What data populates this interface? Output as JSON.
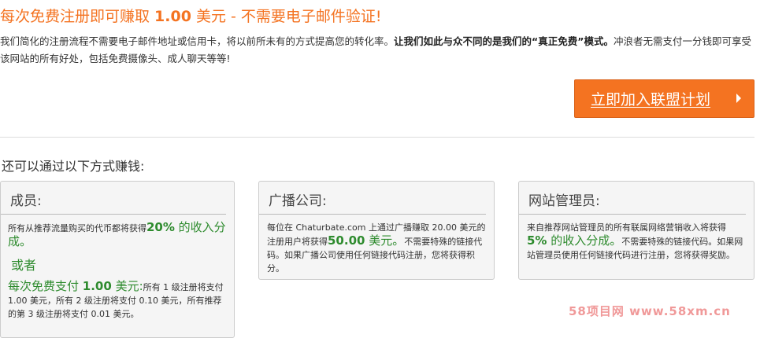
{
  "header": {
    "headline_pre": "每次免费注册即可赚取 ",
    "headline_amount": "1.00",
    "headline_post": " 美元 - 不需要电子邮件验证!"
  },
  "intro": {
    "text_plain": "我们简化的注册流程不需要电子邮件地址或信用卡，将以前所未有的方式提高您的转化率。",
    "text_bold": "让我们如此与众不同的是我们的“真正免费”模式。",
    "text_tail": "冲浪者无需支付一分钱即可享受该网站的所有好处，包括免费摄像头、成人聊天等等!"
  },
  "cta": {
    "join_label": "立即加入联盟计划"
  },
  "section": {
    "title": "还可以通过以下方式赚钱:"
  },
  "cards": [
    {
      "title": "成员:",
      "line1_pre": "所有从推荐流量购买的代币都将获得",
      "line1_pct": "20%",
      "line1_post": " 的收入分成。",
      "or": "或者",
      "line2_pre": "每次免费支付 ",
      "line2_amount": "1.00",
      "line2_post": " 美元:",
      "line2_tail": "所有 1 级注册将支付 1.00 美元，所有 2 级注册将支付 0.10 美元，所有推荐的第 3 级注册将支付 0.01 美元。"
    },
    {
      "title": "广播公司:",
      "line1_pre": "每位在 Chaturbate.com 上通过广播赚取 20.00 美元的注册用户将获得",
      "line1_amount": "50.00",
      "line1_post": " 美元。",
      "line1_tail": "不需要特殊的链接代码。如果广播公司使用任何链接代码注册，您将获得积分。"
    },
    {
      "title": "网站管理员:",
      "line1_pre": "来自推荐网站管理员的所有联属网络营销收入将获得",
      "line1_pct": "5%",
      "line1_post": " 的收入分成。",
      "line1_tail": "不需要特殊的链接代码。如果网站管理员使用任何链接代码进行注册，您将获得奖励。"
    }
  ],
  "watermark": {
    "text": "58项目网 www.58xm.cn"
  },
  "colors": {
    "accent": "#f47321",
    "green": "#2e8b2e"
  }
}
